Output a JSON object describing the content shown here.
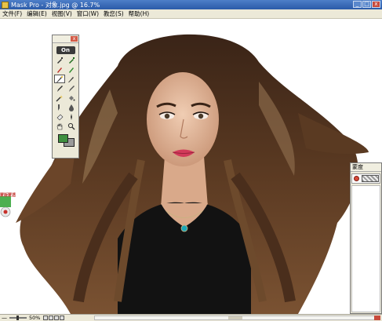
{
  "window": {
    "title": "Mask Pro - 对象.jpg @ 16.7%",
    "buttons": [
      "_",
      "□",
      "x"
    ]
  },
  "menubar": {
    "items": [
      "文件(F)",
      "编辑(E)",
      "视图(V)",
      "窗口(W)",
      "教您(S)",
      "帮助(H)"
    ]
  },
  "tool_palette": {
    "logo": "On",
    "close": "x",
    "tools": [
      {
        "icon": "drop-eyedropper-icon"
      },
      {
        "icon": "keep-eyedropper-icon"
      },
      {
        "icon": "drop-highlighter-icon"
      },
      {
        "icon": "keep-highlighter-icon"
      },
      {
        "icon": "magic-brush-icon",
        "selected": true
      },
      {
        "icon": "brush-icon"
      },
      {
        "icon": "magic-pen-icon"
      },
      {
        "icon": "pen-icon"
      },
      {
        "icon": "magic-wand-icon"
      },
      {
        "icon": "fill-icon"
      },
      {
        "icon": "chisel-icon"
      },
      {
        "icon": "blur-icon"
      },
      {
        "icon": "eraser-icon"
      },
      {
        "icon": "dropper-icon"
      },
      {
        "icon": "hand-icon"
      },
      {
        "icon": "zoom-icon"
      }
    ],
    "colors": {
      "foreground": "#3f8f3f",
      "background": "#9a9a9a"
    }
  },
  "layers_panel": {
    "title": "蒙度"
  },
  "statusbar": {
    "zoom_minus": "—",
    "zoom": "50%"
  },
  "edge_fragment": {
    "label": "蒙版蒙透"
  },
  "colors": {
    "titlebar": "#2b5aa8",
    "chrome": "#ece9d8",
    "hair": "#4a2e1c",
    "skin": "#e0b89c",
    "top": "#121212",
    "necklace": "#1aa6b8"
  }
}
